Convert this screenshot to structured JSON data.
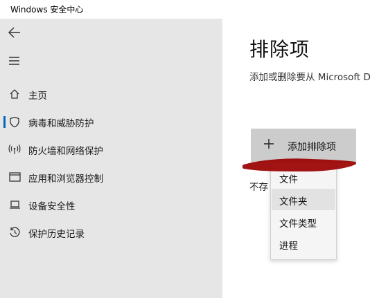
{
  "window": {
    "title": "Windows 安全中心"
  },
  "sidebar": {
    "items": [
      {
        "label": "主页",
        "icon": "home-icon"
      },
      {
        "label": "病毒和威胁防护",
        "icon": "shield-icon",
        "active": true
      },
      {
        "label": "防火墙和网络保护",
        "icon": "wifi-antenna-icon"
      },
      {
        "label": "应用和浏览器控制",
        "icon": "app-window-icon"
      },
      {
        "label": "设备安全性",
        "icon": "laptop-icon"
      },
      {
        "label": "保护历史记录",
        "icon": "history-icon"
      }
    ]
  },
  "main": {
    "title": "排除项",
    "subtitle": "添加或删除要从 Microsoft D",
    "add_button_label": "添加排除项",
    "empty_text": "不存",
    "dropdown": {
      "options": [
        "文件",
        "文件夹",
        "文件类型",
        "进程"
      ],
      "highlighted": "文件夹"
    }
  },
  "colors": {
    "sidebar_bg": "#e6e6e6",
    "accent": "#0067c0",
    "button_bg": "#cccccc",
    "scribble": "#9b0000"
  }
}
